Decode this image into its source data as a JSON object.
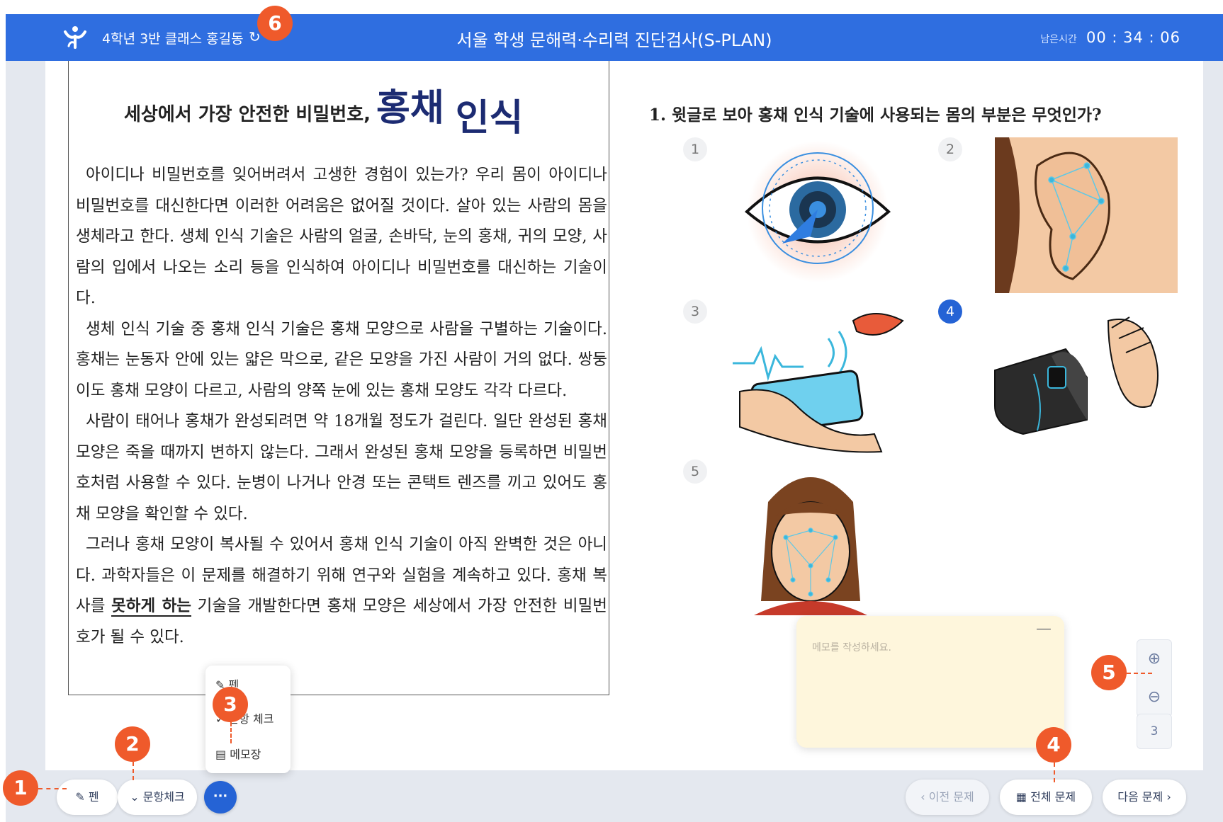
{
  "header": {
    "class_info": "4학년 3반 클래스 홍길동",
    "refresh_icon": "↻",
    "title": "서울 학생 문해력·수리력 진단검사(S-PLAN)",
    "timer_label": "남은시간",
    "timer_value": "00 : 34 : 06"
  },
  "passage": {
    "title_small": "세상에서 가장 안전한 비밀번호,",
    "title_big1": "홍채",
    "title_big2": "인식",
    "paragraphs": [
      "아이디나 비밀번호를 잊어버려서 고생한 경험이 있는가? 우리 몸이 아이디나 비밀번호를 대신한다면 이러한 어려움은 없어질 것이다. 살아 있는 사람의 몸을 생체라고 한다. 생체 인식 기술은 사람의 얼굴, 손바닥, 눈의 홍채, 귀의 모양, 사람의 입에서 나오는 소리 등을 인식하여 아이디나 비밀번호를 대신하는 기술이다.",
      "생체 인식 기술 중 홍채 인식 기술은 홍채 모양으로 사람을 구별하는 기술이다. 홍채는 눈동자 안에 있는 얇은 막으로, 같은 모양을 가진 사람이 거의 없다. 쌍둥이도 홍채 모양이 다르고, 사람의 양쪽 눈에 있는 홍채 모양도 각각 다르다.",
      "사람이 태어나 홍채가 완성되려면 약 18개월 정도가 걸린다. 일단 완성된 홍채 모양은 죽을 때까지 변하지 않는다. 그래서 완성된 홍채 모양을 등록하면 비밀번호처럼 사용할 수 있다. 눈병이 나거나 안경 또는 콘택트 렌즈를 끼고 있어도 홍채 모양을 확인할 수 있다."
    ],
    "p4_before": "그러나 홍채 모양이 복사될 수 있어서 홍채 인식 기술이 아직 완벽한 것은 아니다. 과학자들은 이 문제를 해결하기 위해 연구와 실험을 계속하고 있다. 홍채 복사를 ",
    "p4_underline": "못하게 하는",
    "p4_after": " 기술을 개발한다면 홍채 모양은 세상에서 가장 안전한 비밀번호가 될 수 있다."
  },
  "question": {
    "text": "1.  윗글로 보아 홍채 인식 기술에 사용되는 몸의 부분은 무엇인가?",
    "options": [
      {
        "num": "1",
        "icon": "eye-iris-scan-icon"
      },
      {
        "num": "2",
        "icon": "ear-scan-icon"
      },
      {
        "num": "3",
        "icon": "voice-phone-icon"
      },
      {
        "num": "4",
        "icon": "fingerprint-scanner-icon"
      },
      {
        "num": "5",
        "icon": "face-scan-icon"
      }
    ],
    "selected": "4"
  },
  "zoom": {
    "in_icon": "⊕",
    "out_icon": "⊖",
    "page": "3"
  },
  "memo": {
    "placeholder": "메모를 작성하세요.",
    "minimize": "—"
  },
  "popup": {
    "pen": "펜",
    "sentence_check": "문항 체크",
    "memo": "메모장"
  },
  "bottom": {
    "pen": "펜",
    "sentence_check": "문항체크",
    "more": "···",
    "prev": "‹  이전 문제",
    "all": "전체 문제",
    "next": "다음 문제  ›"
  },
  "callouts": [
    "1",
    "2",
    "3",
    "4",
    "5",
    "6"
  ],
  "colors": {
    "header": "#2f6ee0",
    "selected": "#2563d5",
    "callout": "#ef5a2b",
    "memo": "#fef6dc",
    "toolbar": "#e4e8ef"
  }
}
